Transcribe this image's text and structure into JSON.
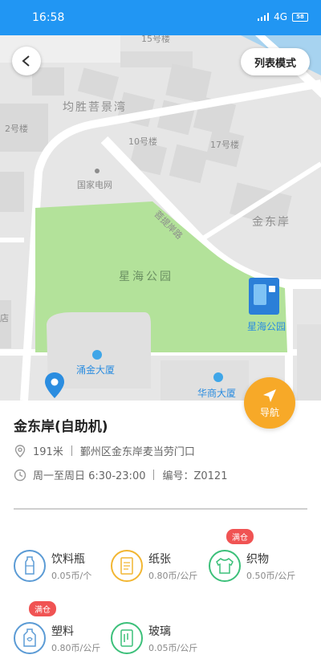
{
  "status_bar": {
    "time": "16:58",
    "network": "4G",
    "battery": "58"
  },
  "map": {
    "labels": {
      "building_15": "15号楼",
      "complex": "均胜菩景湾",
      "building_2": "2号楼",
      "building_10": "10号楼",
      "building_17": "17号楼",
      "power_grid": "国家电网",
      "road": "菩提岸路",
      "jindong": "金东岸",
      "park": "星海公园",
      "station": "星海公园",
      "shop": "店",
      "yongjin": "涌金大厦",
      "huashang": "华商大厦"
    },
    "list_mode_label": "列表模式"
  },
  "nav_label": "导航",
  "station": {
    "name": "金东岸(自助机)",
    "distance": "191米",
    "address": "鄞州区金东岸麦当劳门口",
    "hours": "周一至周日 6:30-23:00",
    "code": "编号：Z0121"
  },
  "categories": [
    {
      "name": "饮料瓶",
      "price": "0.05币/个",
      "color": "#5b9bd5",
      "icon": "bottle-icon",
      "full": false
    },
    {
      "name": "纸张",
      "price": "0.80币/公斤",
      "color": "#f2b632",
      "icon": "paper-icon",
      "full": false
    },
    {
      "name": "织物",
      "price": "0.50币/公斤",
      "color": "#3cc07a",
      "icon": "fabric-icon",
      "full": true
    },
    {
      "name": "塑料",
      "price": "0.80币/公斤",
      "color": "#5b9bd5",
      "icon": "plastic-icon",
      "full": true
    },
    {
      "name": "玻璃",
      "price": "0.05币/公斤",
      "color": "#3cc07a",
      "icon": "glass-icon",
      "full": false
    }
  ],
  "full_badge": "满仓"
}
